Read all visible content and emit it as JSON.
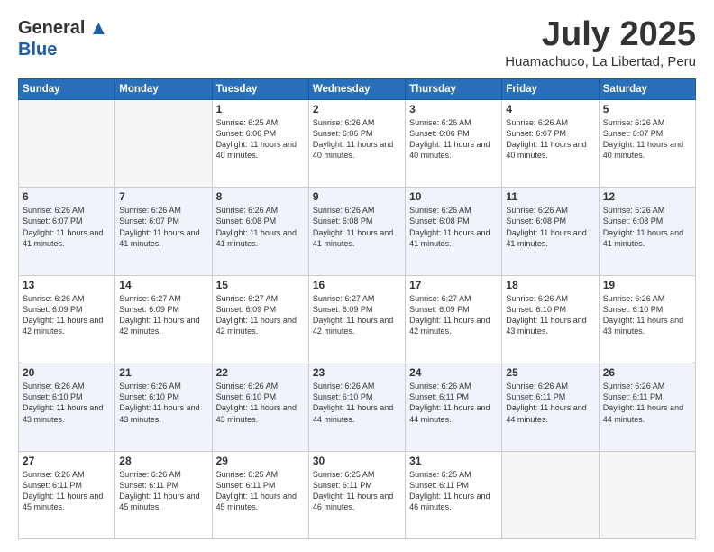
{
  "logo": {
    "general": "General",
    "blue": "Blue"
  },
  "header": {
    "month": "July 2025",
    "location": "Huamachuco, La Libertad, Peru"
  },
  "weekdays": [
    "Sunday",
    "Monday",
    "Tuesday",
    "Wednesday",
    "Thursday",
    "Friday",
    "Saturday"
  ],
  "weeks": [
    [
      {
        "day": "",
        "sunrise": "",
        "sunset": "",
        "daylight": ""
      },
      {
        "day": "",
        "sunrise": "",
        "sunset": "",
        "daylight": ""
      },
      {
        "day": "1",
        "sunrise": "Sunrise: 6:25 AM",
        "sunset": "Sunset: 6:06 PM",
        "daylight": "Daylight: 11 hours and 40 minutes."
      },
      {
        "day": "2",
        "sunrise": "Sunrise: 6:26 AM",
        "sunset": "Sunset: 6:06 PM",
        "daylight": "Daylight: 11 hours and 40 minutes."
      },
      {
        "day": "3",
        "sunrise": "Sunrise: 6:26 AM",
        "sunset": "Sunset: 6:06 PM",
        "daylight": "Daylight: 11 hours and 40 minutes."
      },
      {
        "day": "4",
        "sunrise": "Sunrise: 6:26 AM",
        "sunset": "Sunset: 6:07 PM",
        "daylight": "Daylight: 11 hours and 40 minutes."
      },
      {
        "day": "5",
        "sunrise": "Sunrise: 6:26 AM",
        "sunset": "Sunset: 6:07 PM",
        "daylight": "Daylight: 11 hours and 40 minutes."
      }
    ],
    [
      {
        "day": "6",
        "sunrise": "Sunrise: 6:26 AM",
        "sunset": "Sunset: 6:07 PM",
        "daylight": "Daylight: 11 hours and 41 minutes."
      },
      {
        "day": "7",
        "sunrise": "Sunrise: 6:26 AM",
        "sunset": "Sunset: 6:07 PM",
        "daylight": "Daylight: 11 hours and 41 minutes."
      },
      {
        "day": "8",
        "sunrise": "Sunrise: 6:26 AM",
        "sunset": "Sunset: 6:08 PM",
        "daylight": "Daylight: 11 hours and 41 minutes."
      },
      {
        "day": "9",
        "sunrise": "Sunrise: 6:26 AM",
        "sunset": "Sunset: 6:08 PM",
        "daylight": "Daylight: 11 hours and 41 minutes."
      },
      {
        "day": "10",
        "sunrise": "Sunrise: 6:26 AM",
        "sunset": "Sunset: 6:08 PM",
        "daylight": "Daylight: 11 hours and 41 minutes."
      },
      {
        "day": "11",
        "sunrise": "Sunrise: 6:26 AM",
        "sunset": "Sunset: 6:08 PM",
        "daylight": "Daylight: 11 hours and 41 minutes."
      },
      {
        "day": "12",
        "sunrise": "Sunrise: 6:26 AM",
        "sunset": "Sunset: 6:08 PM",
        "daylight": "Daylight: 11 hours and 41 minutes."
      }
    ],
    [
      {
        "day": "13",
        "sunrise": "Sunrise: 6:26 AM",
        "sunset": "Sunset: 6:09 PM",
        "daylight": "Daylight: 11 hours and 42 minutes."
      },
      {
        "day": "14",
        "sunrise": "Sunrise: 6:27 AM",
        "sunset": "Sunset: 6:09 PM",
        "daylight": "Daylight: 11 hours and 42 minutes."
      },
      {
        "day": "15",
        "sunrise": "Sunrise: 6:27 AM",
        "sunset": "Sunset: 6:09 PM",
        "daylight": "Daylight: 11 hours and 42 minutes."
      },
      {
        "day": "16",
        "sunrise": "Sunrise: 6:27 AM",
        "sunset": "Sunset: 6:09 PM",
        "daylight": "Daylight: 11 hours and 42 minutes."
      },
      {
        "day": "17",
        "sunrise": "Sunrise: 6:27 AM",
        "sunset": "Sunset: 6:09 PM",
        "daylight": "Daylight: 11 hours and 42 minutes."
      },
      {
        "day": "18",
        "sunrise": "Sunrise: 6:26 AM",
        "sunset": "Sunset: 6:10 PM",
        "daylight": "Daylight: 11 hours and 43 minutes."
      },
      {
        "day": "19",
        "sunrise": "Sunrise: 6:26 AM",
        "sunset": "Sunset: 6:10 PM",
        "daylight": "Daylight: 11 hours and 43 minutes."
      }
    ],
    [
      {
        "day": "20",
        "sunrise": "Sunrise: 6:26 AM",
        "sunset": "Sunset: 6:10 PM",
        "daylight": "Daylight: 11 hours and 43 minutes."
      },
      {
        "day": "21",
        "sunrise": "Sunrise: 6:26 AM",
        "sunset": "Sunset: 6:10 PM",
        "daylight": "Daylight: 11 hours and 43 minutes."
      },
      {
        "day": "22",
        "sunrise": "Sunrise: 6:26 AM",
        "sunset": "Sunset: 6:10 PM",
        "daylight": "Daylight: 11 hours and 43 minutes."
      },
      {
        "day": "23",
        "sunrise": "Sunrise: 6:26 AM",
        "sunset": "Sunset: 6:10 PM",
        "daylight": "Daylight: 11 hours and 44 minutes."
      },
      {
        "day": "24",
        "sunrise": "Sunrise: 6:26 AM",
        "sunset": "Sunset: 6:11 PM",
        "daylight": "Daylight: 11 hours and 44 minutes."
      },
      {
        "day": "25",
        "sunrise": "Sunrise: 6:26 AM",
        "sunset": "Sunset: 6:11 PM",
        "daylight": "Daylight: 11 hours and 44 minutes."
      },
      {
        "day": "26",
        "sunrise": "Sunrise: 6:26 AM",
        "sunset": "Sunset: 6:11 PM",
        "daylight": "Daylight: 11 hours and 44 minutes."
      }
    ],
    [
      {
        "day": "27",
        "sunrise": "Sunrise: 6:26 AM",
        "sunset": "Sunset: 6:11 PM",
        "daylight": "Daylight: 11 hours and 45 minutes."
      },
      {
        "day": "28",
        "sunrise": "Sunrise: 6:26 AM",
        "sunset": "Sunset: 6:11 PM",
        "daylight": "Daylight: 11 hours and 45 minutes."
      },
      {
        "day": "29",
        "sunrise": "Sunrise: 6:25 AM",
        "sunset": "Sunset: 6:11 PM",
        "daylight": "Daylight: 11 hours and 45 minutes."
      },
      {
        "day": "30",
        "sunrise": "Sunrise: 6:25 AM",
        "sunset": "Sunset: 6:11 PM",
        "daylight": "Daylight: 11 hours and 46 minutes."
      },
      {
        "day": "31",
        "sunrise": "Sunrise: 6:25 AM",
        "sunset": "Sunset: 6:11 PM",
        "daylight": "Daylight: 11 hours and 46 minutes."
      },
      {
        "day": "",
        "sunrise": "",
        "sunset": "",
        "daylight": ""
      },
      {
        "day": "",
        "sunrise": "",
        "sunset": "",
        "daylight": ""
      }
    ]
  ]
}
